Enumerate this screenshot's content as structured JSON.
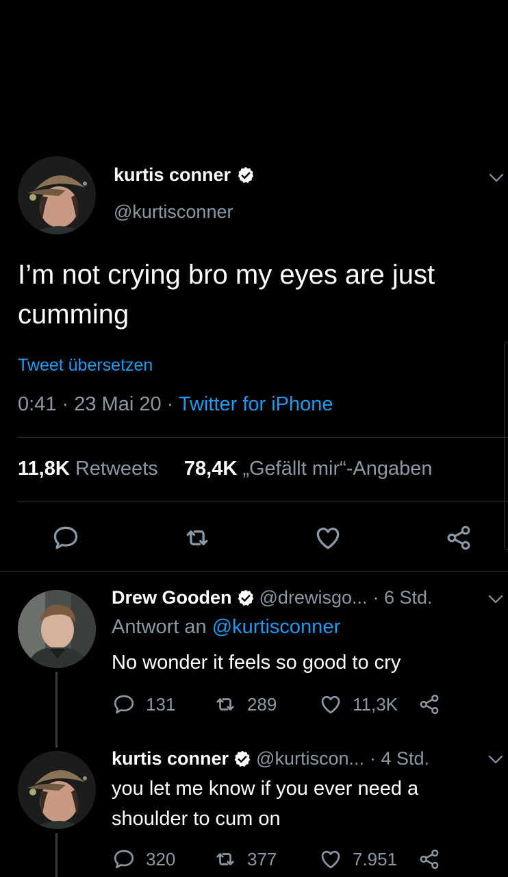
{
  "main_tweet": {
    "author_name": "kurtis conner",
    "handle": "@kurtisconner",
    "text": "I’m not crying bro my eyes are just cumming",
    "translate_label": "Tweet übersetzen",
    "time": "0:41",
    "date": "23 Mai 20",
    "source": "Twitter for iPhone",
    "retweets_count": "11,8K",
    "retweets_label": "Retweets",
    "likes_count": "78,4K",
    "likes_label": "„Gefällt mir“-Angaben"
  },
  "replies": [
    {
      "author_name": "Drew Gooden",
      "handle": "@drewisgo...",
      "time": "· 6 Std.",
      "reply_to_label": "Antwort an",
      "reply_to_handle": "@kurtisconner",
      "text": "No wonder it feels so good to cry",
      "replies_count": "131",
      "retweets_count": "289",
      "likes_count": "11,3K"
    },
    {
      "author_name": "kurtis conner",
      "handle": "@kurtiscon...",
      "time": "· 4 Std.",
      "text": "you let me know if you ever need a shoulder to cum on",
      "replies_count": "320",
      "retweets_count": "377",
      "likes_count": "7.951"
    }
  ],
  "colors": {
    "background": "#000000",
    "link": "#1d9bf0",
    "secondary_text": "#8b98a5",
    "divider": "#2a2f33"
  },
  "icons": [
    "verified-badge-icon",
    "chevron-down-icon",
    "reply-icon",
    "retweet-icon",
    "like-icon",
    "share-icon"
  ]
}
